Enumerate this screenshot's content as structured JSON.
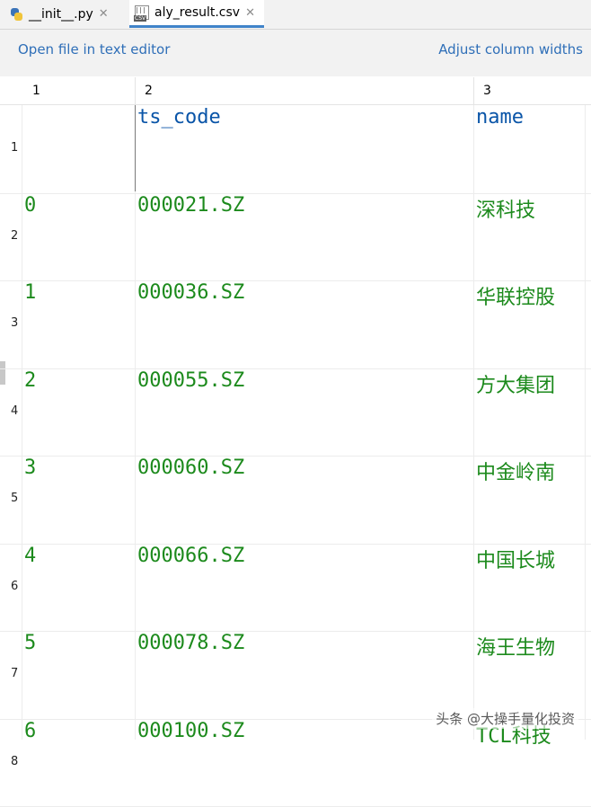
{
  "tabs": [
    {
      "label": "__init__.py",
      "icon": "python-file-icon",
      "active": false
    },
    {
      "label": "aly_result.csv",
      "icon": "csv-file-icon",
      "active": true
    }
  ],
  "toolbar": {
    "open_label": "Open file in text editor",
    "adjust_label": "Adjust column widths"
  },
  "columns": [
    "1",
    "2",
    "3"
  ],
  "rows": [
    {
      "num": "1",
      "c1": "",
      "c2": "ts_code",
      "c3": "name"
    },
    {
      "num": "2",
      "c1": "0",
      "c2": "000021.SZ",
      "c3": "深科技"
    },
    {
      "num": "3",
      "c1": "1",
      "c2": "000036.SZ",
      "c3": "华联控股"
    },
    {
      "num": "4",
      "c1": "2",
      "c2": "000055.SZ",
      "c3": "方大集团"
    },
    {
      "num": "5",
      "c1": "3",
      "c2": "000060.SZ",
      "c3": "中金岭南"
    },
    {
      "num": "6",
      "c1": "4",
      "c2": "000066.SZ",
      "c3": "中国长城"
    },
    {
      "num": "7",
      "c1": "5",
      "c2": "000078.SZ",
      "c3": "海王生物"
    },
    {
      "num": "8",
      "c1": "6",
      "c2": "000100.SZ",
      "c3": "TCL科技"
    }
  ],
  "watermark": "头条 @大操手量化投资",
  "colors": {
    "header_text": "#0a55a8",
    "value_text": "#1c8a1c",
    "link": "#2f6fb8",
    "active_tab": "#4083c9"
  }
}
